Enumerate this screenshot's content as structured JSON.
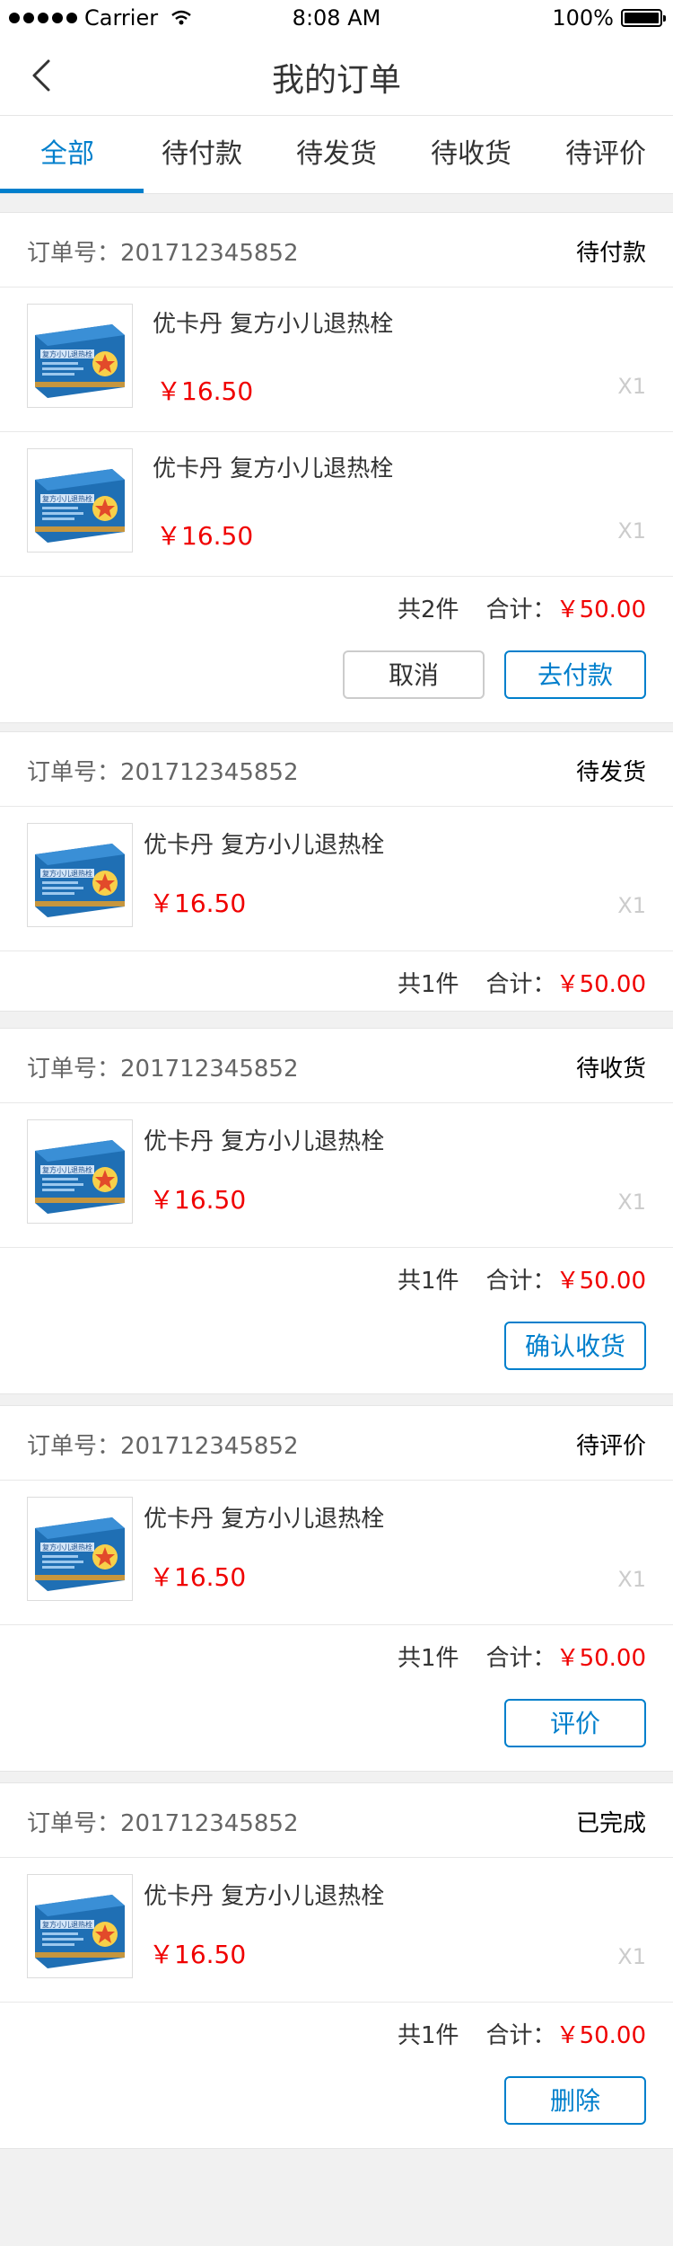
{
  "status_bar": {
    "carrier": "Carrier",
    "time": "8:08 AM",
    "battery": "100%"
  },
  "nav": {
    "title": "我的订单"
  },
  "tabs": [
    {
      "label": "全部",
      "active": true
    },
    {
      "label": "待付款"
    },
    {
      "label": "待发货"
    },
    {
      "label": "待收货"
    },
    {
      "label": "待评价"
    }
  ],
  "colors": {
    "accent": "#007FCC",
    "price": "#F00000",
    "text": "#333333",
    "muted": "#666666"
  },
  "orders": [
    {
      "order_no_label": "订单号：201712345852",
      "status": "待付款",
      "items": [
        {
          "name": "优卡丹 复方小儿退热栓",
          "price": "￥16.50",
          "qty": "X1"
        },
        {
          "name": "优卡丹 复方小儿退热栓",
          "price": "￥16.50",
          "qty": "X1"
        }
      ],
      "count": "共2件",
      "total_label": "合计：",
      "total": "￥50.00",
      "buttons": [
        "取消",
        "去付款"
      ]
    },
    {
      "order_no_label": "订单号：201712345852",
      "status": "待发货",
      "items": [
        {
          "name": "优卡丹 复方小儿退热栓",
          "price": "￥16.50",
          "qty": "X1"
        }
      ],
      "count": "共1件",
      "total_label": "合计：",
      "total": "￥50.00",
      "buttons": []
    },
    {
      "order_no_label": "订单号：201712345852",
      "status": "待收货",
      "items": [
        {
          "name": "优卡丹 复方小儿退热栓",
          "price": "￥16.50",
          "qty": "X1"
        }
      ],
      "count": "共1件",
      "total_label": "合计：",
      "total": "￥50.00",
      "buttons": [
        "确认收货"
      ]
    },
    {
      "order_no_label": "订单号：201712345852",
      "status": "待评价",
      "items": [
        {
          "name": "优卡丹 复方小儿退热栓",
          "price": "￥16.50",
          "qty": "X1"
        }
      ],
      "count": "共1件",
      "total_label": "合计：",
      "total": "￥50.00",
      "buttons": [
        "评价"
      ]
    },
    {
      "order_no_label": "订单号：201712345852",
      "status": "已完成",
      "items": [
        {
          "name": "优卡丹 复方小儿退热栓",
          "price": "￥16.50",
          "qty": "X1"
        }
      ],
      "count": "共1件",
      "total_label": "合计：",
      "total": "￥50.00",
      "buttons": [
        "删除"
      ]
    }
  ],
  "icons": {
    "back": "back-chevron-icon",
    "signal": "signal-dots-icon",
    "wifi": "wifi-icon",
    "battery": "battery-icon"
  },
  "product_box_text": "复方小儿退热栓"
}
